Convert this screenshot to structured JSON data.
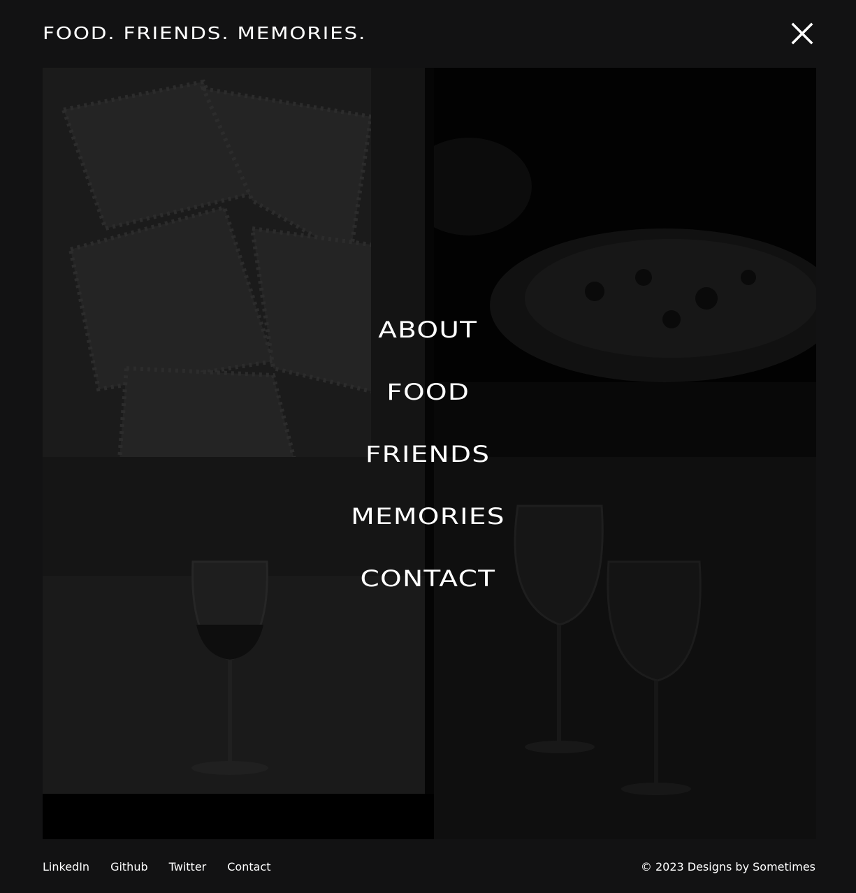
{
  "header": {
    "brand": "FOOD. FRIENDS. MEMORIES.",
    "close_icon": "close-icon"
  },
  "menu": {
    "items": [
      {
        "label": "ABOUT"
      },
      {
        "label": "FOOD"
      },
      {
        "label": "FRIENDS"
      },
      {
        "label": "MEMORIES"
      },
      {
        "label": "CONTACT"
      }
    ]
  },
  "footer": {
    "links": [
      {
        "label": "LinkedIn"
      },
      {
        "label": "Github"
      },
      {
        "label": "Twitter"
      },
      {
        "label": "Contact"
      }
    ],
    "copyright": "© 2023 Designs by Sometimes"
  },
  "colors": {
    "background": "#121213",
    "text": "#ffffff"
  }
}
